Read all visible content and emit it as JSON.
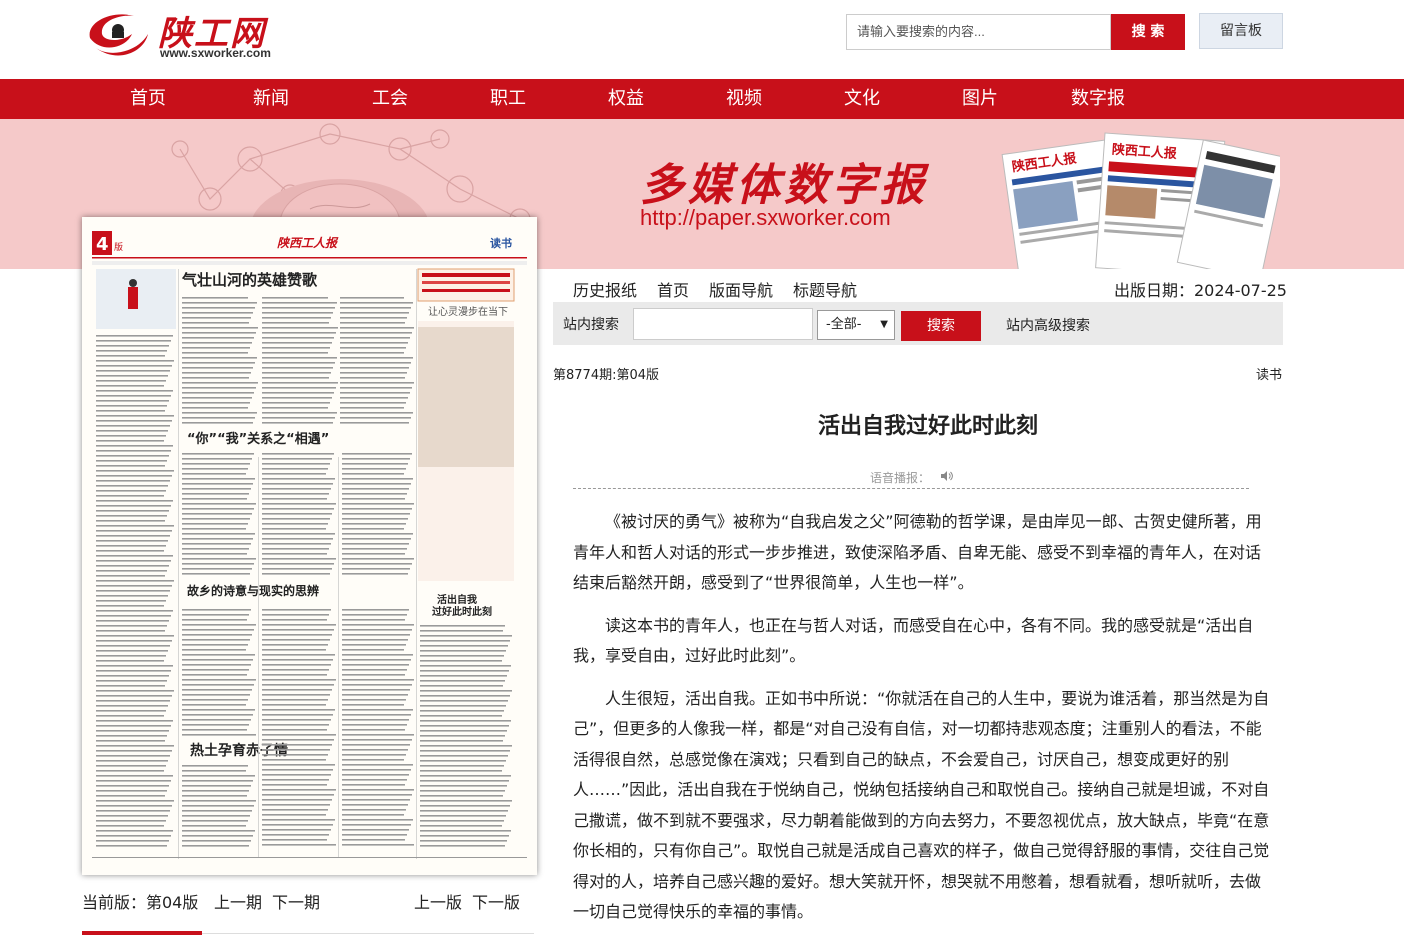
{
  "header": {
    "logo_text": "陕工网",
    "logo_url": "www.sxworker.com",
    "search_placeholder": "请输入要搜索的内容...",
    "search_button": "搜 索",
    "message_board": "留言板"
  },
  "nav": {
    "items": [
      "首页",
      "新闻",
      "工会",
      "职工",
      "权益",
      "视频",
      "文化",
      "图片",
      "数字报"
    ]
  },
  "banner": {
    "title": "多媒体数字报",
    "url": "http://paper.sxworker.com"
  },
  "paper_preview": {
    "page_number": "4",
    "page_suffix": "版",
    "masthead": "陕西工人报",
    "section": "读书",
    "headlines": [
      "气壮山河的英雄赞歌",
      "“你”“我”关系之“相遇”",
      "故乡的诗意与现实的思辨",
      "热土孕育赤子情",
      "活出自我\n过好此时此刻",
      "让心灵漫步在当下"
    ]
  },
  "paper_nav": {
    "current_label": "当前版：第04版",
    "prev_issue": "上一期",
    "next_issue": "下一期",
    "prev_page": "上一版",
    "next_page": "下一版"
  },
  "sub_nav": {
    "items": [
      "历史报纸",
      "首页",
      "版面导航",
      "标题导航"
    ],
    "pub_date": "出版日期：2024-07-25"
  },
  "site_search": {
    "label": "站内搜索",
    "select_value": "-全部-",
    "button": "搜索",
    "advanced": "站内高级搜索"
  },
  "article": {
    "issue": "第8774期:第04版",
    "section": "读书",
    "title": "活出自我过好此时此刻",
    "voice_label": "语音播报：",
    "paragraphs": [
      "《被讨厌的勇气》被称为“自我启发之父”阿德勒的哲学课，是由岸见一郎、古贺史健所著，用青年人和哲人对话的形式一步步推进，致使深陷矛盾、自卑无能、感受不到幸福的青年人，在对话结束后豁然开朗，感受到了“世界很简单，人生也一样”。",
      "读这本书的青年人，也正在与哲人对话，而感受自在心中，各有不同。我的感受就是“活出自我，享受自由，过好此时此刻”。",
      "人生很短，活出自我。正如书中所说：“你就活在自己的人生中，要说为谁活着，那当然是为自己”，但更多的人像我一样，都是“对自己没有自信，对一切都持悲观态度；注重别人的看法，不能活得很自然，总感觉像在演戏；只看到自己的缺点，不会爱自己，讨厌自己，想变成更好的别人……”因此，活出自我在于悦纳自己，悦纳包括接纳自己和取悦自己。接纳自己就是坦诚，不对自己撒谎，做不到就不要强求，尽力朝着能做到的方向去努力，不要忽视优点，放大缺点，毕竟“在意你长相的，只有你自己”。取悦自己就是活成自己喜欢的样子，做自己觉得舒服的事情，交往自己觉得对的人，培养自己感兴趣的爱好。想大笑就开怀，想哭就不用憋着，想看就看，想听就听，去做一切自己觉得快乐的幸福的事情。"
    ]
  },
  "colors": {
    "brand_red": "#c8101a",
    "banner_pink": "#f5c9c9"
  }
}
